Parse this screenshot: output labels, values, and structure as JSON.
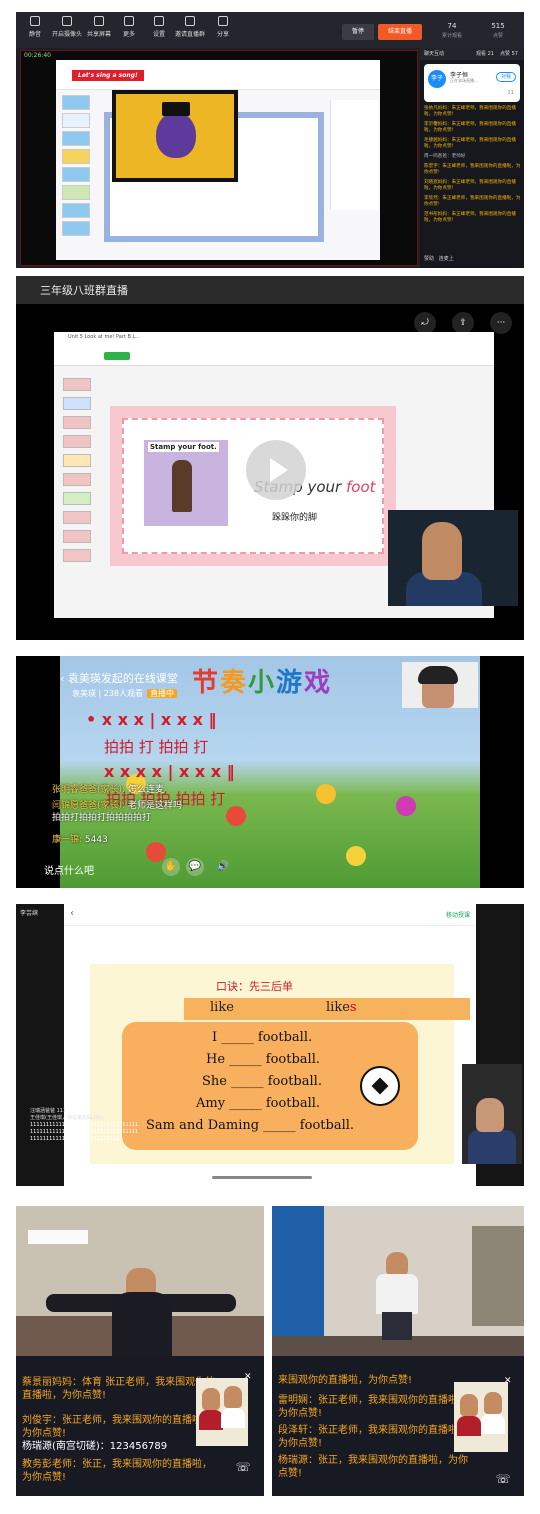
{
  "panel1": {
    "toolbar": [
      {
        "label": "静音"
      },
      {
        "label": "开启摄像头"
      },
      {
        "label": "共享屏幕"
      },
      {
        "label": "更多"
      },
      {
        "label": "设置"
      },
      {
        "label": "邀请直播群"
      },
      {
        "label": "分享"
      }
    ],
    "pause_label": "暂停",
    "end_live_label": "结束直播",
    "stats": [
      {
        "value": "74",
        "label": "累计观看"
      },
      {
        "value": "515",
        "label": "点赞"
      }
    ],
    "timer": "00:26:40",
    "slide_banner": "Let's sing a song!",
    "chat_tabs": {
      "chat": "聊天互动",
      "watchers": "观看 21",
      "comments": "点赞 57"
    },
    "host": {
      "avatar": "李子",
      "name": "李子恒",
      "sub": "正在本场直播...",
      "follow": "对我",
      "count": "21"
    },
    "messages": [
      {
        "text": "张依凡妈妈：朱正峰老师，我来围观你的直播啦，为你点赞!",
        "style": "y"
      },
      {
        "text": "李沂馨妈妈：朱正峰老师，我来围观你的直播啦，为你点赞!",
        "style": "y"
      },
      {
        "text": "毛捷越妈妈：朱正峰老师，我来围观你的直播啦，为你点赞!",
        "style": "y"
      },
      {
        "text": "周一鸣爸爸：老师好",
        "style": "w"
      },
      {
        "text": "陈宏宇：朱正峰老师，我来围观你的直播啦，为你点赞!",
        "style": "y"
      },
      {
        "text": "刘晓宸妈妈：朱正峰老师，我来围观你的直播啦，为你点赞!",
        "style": "y"
      },
      {
        "text": "李欣然：朱正峰老师，我来围观你的直播啦，为你点赞!",
        "style": "y"
      },
      {
        "text": "范书彤妈妈：朱正峰老师，我来围观你的直播啦，为你点赞!",
        "style": "y"
      }
    ],
    "footer": {
      "a": "赞助",
      "b": "连麦上"
    }
  },
  "panel2": {
    "title": "三年级八班群直播",
    "ppt_title": "Unit 5 Look at me! Part B.L...",
    "card_text": "Stamp your foot.",
    "en_prefix": "Stamp your ",
    "en_colored": "foot",
    "cn_text": "跺跺你的脚",
    "controls": [
      "⤾",
      "⇪",
      "···"
    ]
  },
  "panel3": {
    "host_title": "袁美瑛发起的在线课堂",
    "host_name": "袁美瑛",
    "viewers": "238人观看",
    "tag": "直播中",
    "game_title": [
      "节",
      "奏",
      "小",
      "游",
      "戏"
    ],
    "title_colors": [
      "#e43c2f",
      "#f59a1e",
      "#2f9b3a",
      "#1f77c8",
      "#9b3fc0"
    ],
    "rhythm_top1": "• x x   x   |   x x   x   ‖",
    "rhythm_hz1": "拍拍   打      拍拍   打",
    "rhythm_top2": "x x  x x  |  x x   x   ‖",
    "rhythm_hz2": "拍拍  拍拍    拍拍   打",
    "comments": [
      {
        "name": "张明睿爸爸(家长):",
        "text": "怎么连麦"
      },
      {
        "name": "闫锦愿爸爸(家长):",
        "text": "老师是这样吗"
      },
      {
        "name": "",
        "text": "拍拍打拍拍打拍拍拍拍打"
      },
      {
        "name": "康一锦:",
        "text": "5443"
      }
    ],
    "say": "说点什么吧"
  },
  "panel4": {
    "tab": "李芸缤",
    "green_btn": "移动授课",
    "rule": "口诀：先三后单",
    "like1": "like",
    "like2_a": "like",
    "like2_b": "s",
    "lines": [
      "I _____ football.",
      "He _____ football.",
      "She _____ football.",
      "Amy _____ football.",
      "Sam and Daming _____ football."
    ],
    "side_top": "汪瑞涵爸爸 111",
    "side_name": "王佳琪(王佳琪，你在家的妈)(张):",
    "side_ones": "1111111111111111111111111111111111111111111111111111111111111111111111111111111111111111111111111"
  },
  "panel5": {
    "comments": [
      {
        "text": "蔡景丽妈妈：体育 张正老师，我来围观你的直播啦，为你点赞!",
        "style": "y"
      },
      {
        "text": "刘俊宇：张正老师，我来围观你的直播啦，为你点赞!",
        "style": "y"
      },
      {
        "text": "杨瑞源(南宫切磋)：123456789",
        "style": "w"
      },
      {
        "text": "教务彭老师：张正，我来围观你的直播啦，为你点赞!",
        "style": "y"
      }
    ]
  },
  "panel6": {
    "comments": [
      {
        "text": "来围观你的直播啦，为你点赞!",
        "style": "y"
      },
      {
        "text": "雷明娴：张正老师，我来围观你的直播啦，为你点赞!",
        "style": "y"
      },
      {
        "text": "段泽轩：张正老师，我来围观你的直播啦，为你点赞!",
        "style": "y"
      },
      {
        "text": "杨瑞源：张正，我来围观你的直播啦，为你点赞!",
        "style": "y"
      }
    ]
  }
}
